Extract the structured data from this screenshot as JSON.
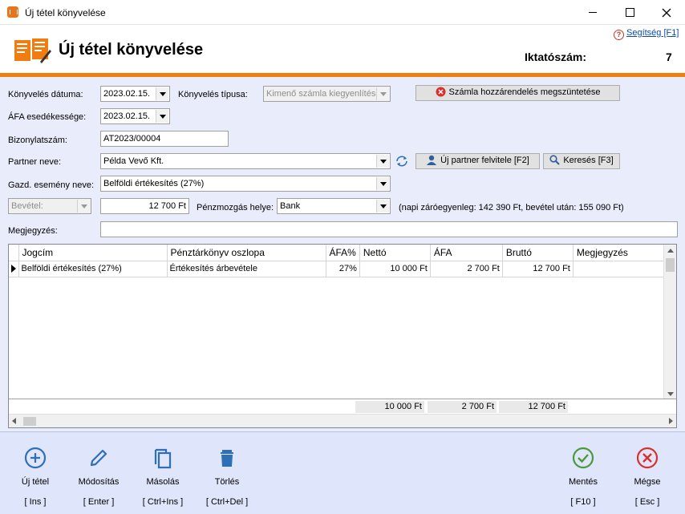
{
  "window": {
    "title": "Új tétel könyvelése"
  },
  "header": {
    "title": "Új tétel könyvelése",
    "help_label": "Segítség [F1]",
    "iktatoszam_label": "Iktatószám:",
    "iktatoszam_value": "7"
  },
  "form": {
    "konyveles_datuma": {
      "label": "Könyvelés dátuma:",
      "value": "2023.02.15."
    },
    "konyveles_tipusa": {
      "label": "Könyvelés típusa:",
      "value": "Kimenő számla kiegyenlítése"
    },
    "szamla_btn": "Számla hozzárendelés megszüntetése",
    "afa_esedekesseg": {
      "label": "ÁFA esedékessége:",
      "value": "2023.02.15."
    },
    "bizonylatszam": {
      "label": "Bizonylatszám:",
      "value": "AT2023/00004"
    },
    "partner": {
      "label": "Partner neve:",
      "value": "Példa Vevő Kft."
    },
    "uj_partner_btn": "Új partner felvitele [F2]",
    "kereses_btn": "Keresés [F3]",
    "gazd_esemeny": {
      "label": "Gazd. esemény neve:",
      "value": "Belföldi értékesítés (27%)"
    },
    "irany": {
      "value": "Bevétel:"
    },
    "osszeg": {
      "value": "12 700 Ft"
    },
    "penzmozgas": {
      "label": "Pénzmozgás helye:",
      "value": "Bank"
    },
    "napi_info": "(napi záróegyenleg: 142 390 Ft, bevétel után: 155 090 Ft)",
    "megjegyzes": {
      "label": "Megjegyzés:",
      "value": ""
    }
  },
  "grid": {
    "columns": [
      "Jogcím",
      "Pénztárkönyv oszlopa",
      "ÁFA%",
      "Nettó",
      "ÁFA",
      "Bruttó",
      "Megjegyzés"
    ],
    "rows": [
      [
        "Belföldi értékesítés (27%)",
        "Értékesítés árbevétele",
        "27%",
        "10 000 Ft",
        "2 700 Ft",
        "12 700 Ft",
        ""
      ]
    ],
    "totals": {
      "netto": "10 000 Ft",
      "afa": "2 700 Ft",
      "brutto": "12 700 Ft"
    }
  },
  "toolbar": {
    "new": {
      "label": "Új tétel",
      "key": "[ Ins ]"
    },
    "edit": {
      "label": "Módosítás",
      "key": "[ Enter ]"
    },
    "copy": {
      "label": "Másolás",
      "key": "[ Ctrl+Ins ]"
    },
    "delete": {
      "label": "Törlés",
      "key": "[ Ctrl+Del ]"
    },
    "save": {
      "label": "Mentés",
      "key": "[ F10 ]"
    },
    "cancel": {
      "label": "Mégse",
      "key": "[ Esc ]"
    }
  },
  "colors": {
    "accent": "#f07d10",
    "form_bg": "#e8ecfb",
    "toolbar_bg": "#dfe5fb",
    "icon_blue": "#2f6fb5",
    "ok_green": "#4b9a3a",
    "cancel_red": "#d9302c"
  }
}
